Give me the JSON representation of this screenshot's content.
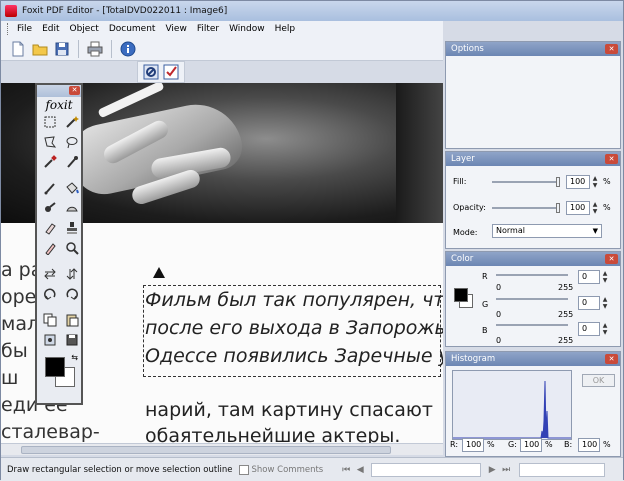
{
  "window": {
    "title": "Foxit PDF Editor - [TotalDVD022011 : Image6]"
  },
  "menu": [
    "File",
    "Edit",
    "Object",
    "Document",
    "View",
    "Filter",
    "Window",
    "Help"
  ],
  "toolbar": {
    "icons": [
      "new-document-icon",
      "open-folder-icon",
      "save-icon",
      "print-icon",
      "info-icon"
    ],
    "secondary_icons": [
      "no-select-icon",
      "checkmark-icon"
    ]
  },
  "document": {
    "left_lines": [
      "а ра ро-",
      "оре  ет",
      "мал  ый",
      "  бы",
      "  ш",
      "еди ее",
      "сталевар-"
    ],
    "right_lines_italic": [
      "Фильм был так популярен, что",
      "после его выхода в Запорожье",
      "Одессе появились Заречные у"
    ],
    "right_lines_plain": [
      "нарий, там картину спасают",
      "обаятельнейшие актеры."
    ]
  },
  "toolbox": {
    "logo": "foxit",
    "tools": [
      "marquee-select-icon",
      "magic-wand-icon",
      "polygon-lasso-icon",
      "lasso-icon",
      "eyedropper-icon",
      "color-picker-icon",
      "brush-icon",
      "paint-bucket-icon",
      "smudge-icon",
      "blur-icon",
      "eraser-icon",
      "stamp-icon",
      "eraser-alt-icon",
      "zoom-icon",
      "flip-horizontal-icon",
      "flip-vertical-icon",
      "rotate-left-icon",
      "rotate-right-icon",
      "copy-icon",
      "paste-icon",
      "crop-icon",
      "save-image-icon"
    ],
    "swap_label": "⇆",
    "fg_color": "#000000",
    "bg_color": "#ffffff"
  },
  "panels": {
    "options": {
      "title": "Options"
    },
    "layer": {
      "title": "Layer",
      "fill_label": "Fill:",
      "fill_value": "100",
      "opacity_label": "Opacity:",
      "opacity_value": "100",
      "percent": "%",
      "mode_label": "Mode:",
      "mode_value": "Normal"
    },
    "color": {
      "title": "Color",
      "r_label": "R",
      "g_label": "G",
      "b_label": "B",
      "r_value": "0",
      "g_value": "0",
      "b_value": "0",
      "min": "0",
      "max": "255"
    },
    "histogram": {
      "title": "Histogram",
      "ok_label": "OK",
      "r_label": "R:",
      "r_value": "100",
      "g_label": "G:",
      "g_value": "100",
      "b_label": "B:",
      "b_value": "100",
      "percent": "%"
    }
  },
  "status": {
    "message": "Draw rectangular selection or move selection outline",
    "show_comments": "Show Comments"
  }
}
